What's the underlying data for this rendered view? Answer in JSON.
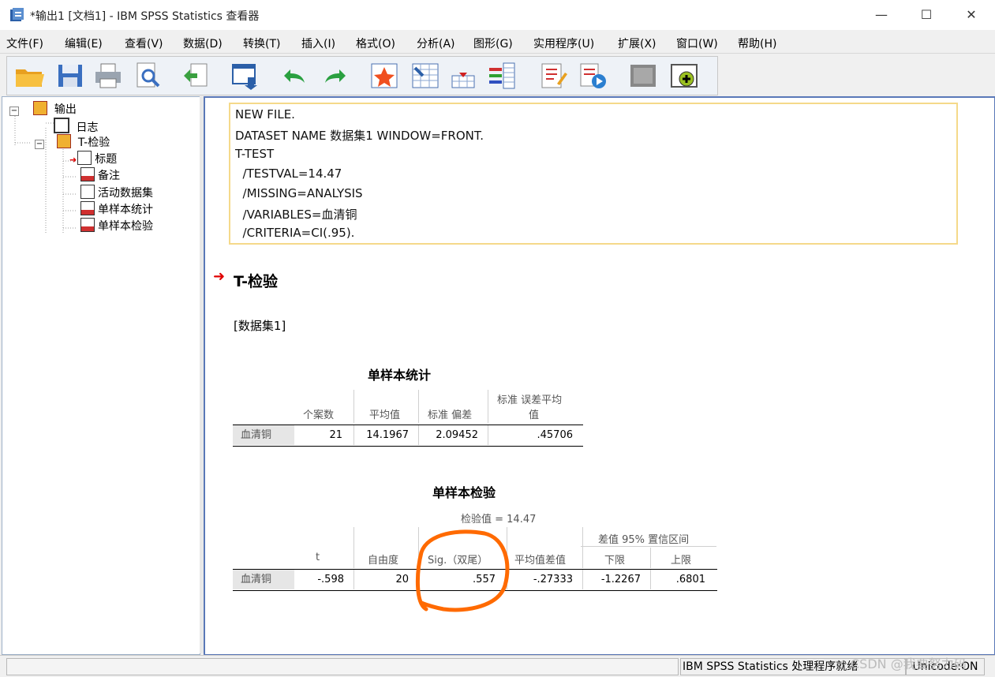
{
  "window": {
    "title": "*输出1 [文档1] - IBM SPSS Statistics 查看器",
    "minimize": "—",
    "maximize": "☐",
    "close": "✕"
  },
  "menu": [
    "文件(F)",
    "编辑(E)",
    "查看(V)",
    "数据(D)",
    "转换(T)",
    "插入(I)",
    "格式(O)",
    "分析(A)",
    "图形(G)",
    "实用程序(U)",
    "扩展(X)",
    "窗口(W)",
    "帮助(H)"
  ],
  "toolbar": {
    "icons": [
      "open-icon",
      "save-icon",
      "print-icon",
      "print-preview-icon",
      "export-icon",
      "recall-dialog-icon",
      "undo-icon",
      "redo-icon",
      "goto-data-icon",
      "goto-case-icon",
      "goto-variable-icon",
      "variables-icon",
      "designate-window-icon",
      "run-script-icon",
      "hide-icon",
      "show-icon"
    ]
  },
  "tree": {
    "root": "输出",
    "log": "日志",
    "ttest": "T-检验",
    "children": [
      "标题",
      "备注",
      "活动数据集",
      "单样本统计",
      "单样本检验"
    ]
  },
  "syntax": [
    "NEW FILE.",
    "DATASET NAME 数据集1 WINDOW=FRONT.",
    "T-TEST",
    "  /TESTVAL=14.47",
    "  /MISSING=ANALYSIS",
    "  /VARIABLES=血清铜",
    "  /CRITERIA=CI(.95)."
  ],
  "section_title": "T-检验",
  "dataset_label": "[数据集1]",
  "stats_table": {
    "title": "单样本统计",
    "headers": [
      "个案数",
      "平均值",
      "标准 偏差",
      "标准 误差平均",
      "值"
    ],
    "row_label": "血清铜",
    "values": [
      "21",
      "14.1967",
      "2.09452",
      ".45706"
    ]
  },
  "test_table": {
    "title": "单样本检验",
    "test_value": "检验值 = 14.47",
    "ci_header": "差值 95% 置信区间",
    "headers": [
      "t",
      "自由度",
      "Sig.（双尾）",
      "平均值差值",
      "下限",
      "上限"
    ],
    "row_label": "血清铜",
    "values": [
      "-.598",
      "20",
      ".557",
      "-.27333",
      "-1.2267",
      ".6801"
    ]
  },
  "status": {
    "processor": "IBM SPSS Statistics 处理程序就绪",
    "unicode": "Unicode:ON",
    "watermark": "CSDN @我要努力码"
  },
  "colors": {
    "highlight_circle": "#ff6a00",
    "accent_border": "#5a78b8",
    "syntax_border": "#f5d98a",
    "arrow": "#e00000"
  }
}
